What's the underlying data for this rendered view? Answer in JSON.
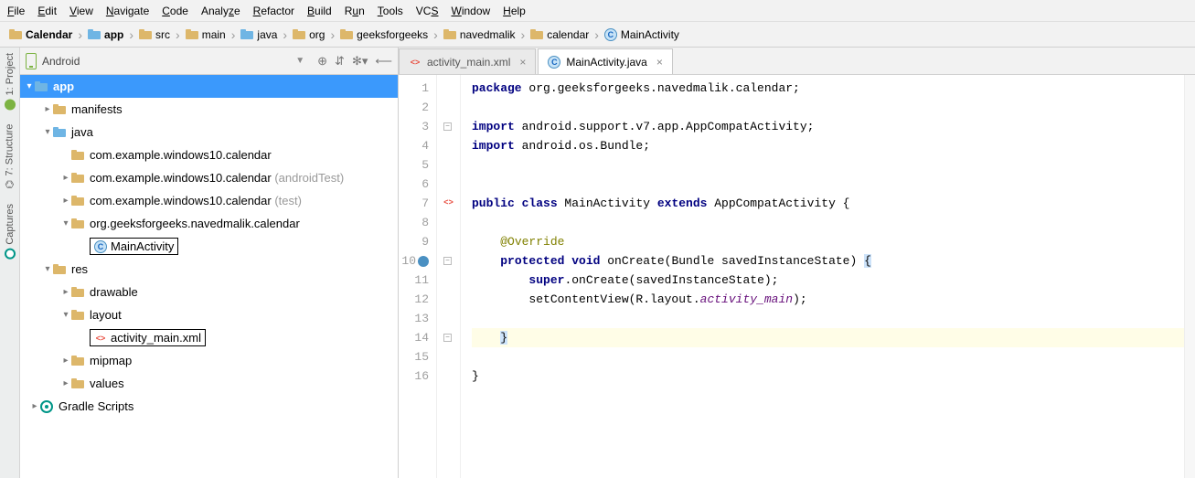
{
  "menu": [
    "File",
    "Edit",
    "View",
    "Navigate",
    "Code",
    "Analyze",
    "Refactor",
    "Build",
    "Run",
    "Tools",
    "VCS",
    "Window",
    "Help"
  ],
  "breadcrumb": [
    {
      "label": "Calendar",
      "icon": "folder",
      "bold": true
    },
    {
      "label": "app",
      "icon": "folder-blue",
      "bold": true
    },
    {
      "label": "src",
      "icon": "folder"
    },
    {
      "label": "main",
      "icon": "folder"
    },
    {
      "label": "java",
      "icon": "folder-blue"
    },
    {
      "label": "org",
      "icon": "folder"
    },
    {
      "label": "geeksforgeeks",
      "icon": "folder"
    },
    {
      "label": "navedmalik",
      "icon": "folder"
    },
    {
      "label": "calendar",
      "icon": "folder"
    },
    {
      "label": "MainActivity",
      "icon": "class"
    }
  ],
  "side_tabs": {
    "project": "1: Project",
    "structure": "7: Structure",
    "captures": "Captures"
  },
  "project_header": {
    "title": "Android"
  },
  "tree": {
    "app": "app",
    "manifests": "manifests",
    "java": "java",
    "pkg1": "com.example.windows10.calendar",
    "pkg2": "com.example.windows10.calendar",
    "pkg2_suffix": " (androidTest)",
    "pkg3": "com.example.windows10.calendar",
    "pkg3_suffix": " (test)",
    "pkg4": "org.geeksforgeeks.navedmalik.calendar",
    "main_activity": "MainActivity",
    "res": "res",
    "drawable": "drawable",
    "layout": "layout",
    "activity_xml": "activity_main.xml",
    "mipmap": "mipmap",
    "values": "values",
    "gradle": "Gradle Scripts"
  },
  "tabs": [
    {
      "icon": "xml",
      "label": "activity_main.xml",
      "active": false
    },
    {
      "icon": "class",
      "label": "MainActivity.java",
      "active": true
    }
  ],
  "code": {
    "lines": [
      "1",
      "2",
      "3",
      "4",
      "5",
      "6",
      "7",
      "8",
      "9",
      "10",
      "11",
      "12",
      "13",
      "14",
      "15",
      "16"
    ],
    "l1_a": "package",
    "l1_b": " org.geeksforgeeks.navedmalik.calendar;",
    "l3_a": "import",
    "l3_b": " android.support.v7.app.AppCompatActivity;",
    "l4_a": "import",
    "l4_b": " android.os.Bundle;",
    "l7_a": "public class",
    "l7_b": " MainActivity ",
    "l7_c": "extends",
    "l7_d": " AppCompatActivity {",
    "l9": "@Override",
    "l10_a": "protected void",
    "l10_b": " onCreate(Bundle savedInstanceState) ",
    "l10_c": "{",
    "l11_a": "super",
    "l11_b": ".onCreate(savedInstanceState);",
    "l12_a": "        setContentView(R.layout.",
    "l12_b": "activity_main",
    "l12_c": ");",
    "l14": "}",
    "l15": "}"
  }
}
